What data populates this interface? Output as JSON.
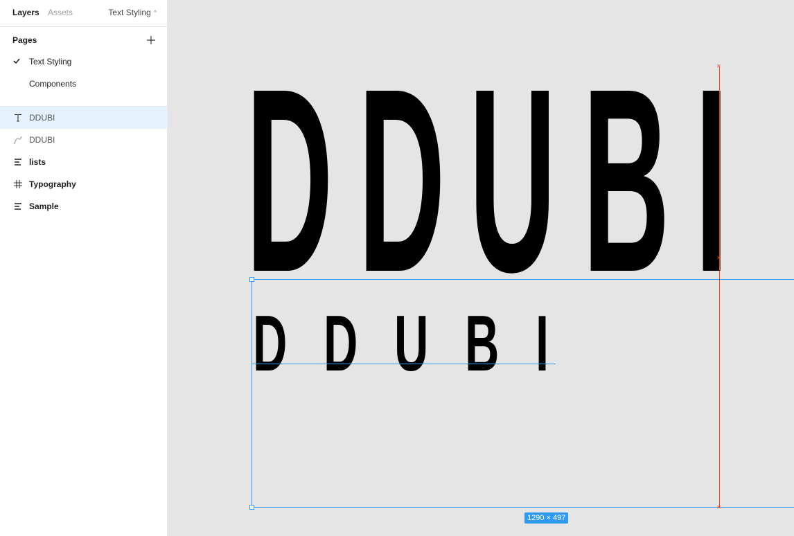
{
  "tabs": {
    "layers": "Layers",
    "assets": "Assets",
    "current_page": "Text Styling"
  },
  "pages": {
    "title": "Pages",
    "items": [
      {
        "label": "Text Styling",
        "active": true
      },
      {
        "label": "Components",
        "active": false
      }
    ]
  },
  "layers": [
    {
      "label": "DDUBI",
      "icon": "text-icon",
      "selected": true
    },
    {
      "label": "DDUBI",
      "icon": "vector-icon",
      "selected": false
    },
    {
      "label": "lists",
      "icon": "text-block-icon",
      "selected": false
    },
    {
      "label": "Typography",
      "icon": "frame-icon",
      "selected": false
    },
    {
      "label": "Sample",
      "icon": "text-block-icon",
      "selected": false
    }
  ],
  "canvas": {
    "big_text": "DDUBI",
    "small_text": "DDUBI",
    "dimensions": "1290 × 497"
  },
  "colors": {
    "selection": "#2f9bf5",
    "measure": "#f24822",
    "canvas": "#e5e5e5"
  }
}
